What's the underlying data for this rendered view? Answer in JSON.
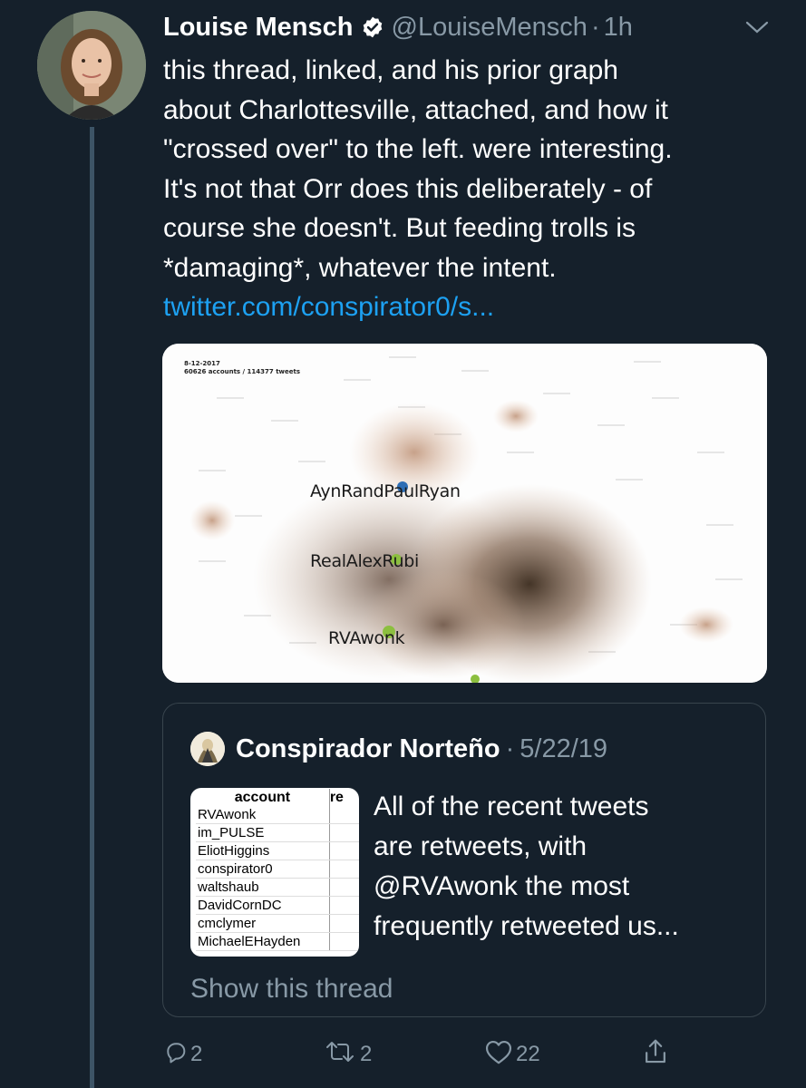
{
  "tweet": {
    "author_name": "Louise Mensch",
    "handle": "@LouiseMensch",
    "separator": "·",
    "time": "1h",
    "body_lines": [
      "this thread, linked, and his prior graph",
      "about Charlottesville, attached, and how it",
      "\"crossed over\" to the left. were interesting.",
      "It's not that Orr does this deliberately - of",
      "course she doesn't. But feeding trolls is",
      "*damaging*, whatever the intent."
    ],
    "link": "twitter.com/conspirator0/s...",
    "icons": {
      "verified": "verified-badge-icon",
      "caret": "chevron-down-icon"
    }
  },
  "media": {
    "date": "8-12-2017",
    "stats": "60626 accounts / 114377 tweets",
    "labels": [
      "AynRandPaulRyan",
      "RealAlexRubi",
      "RVAwonk"
    ]
  },
  "quote": {
    "author_name": "Conspirador Norteño",
    "separator": "·",
    "date": "5/22/19",
    "table": {
      "header": [
        "account",
        "re"
      ],
      "rows": [
        "RVAwonk",
        "im_PULSE",
        "EliotHiggins",
        "conspirator0",
        "waltshaub",
        "DavidCornDC",
        "cmclymer",
        "MichaelEHayden"
      ]
    },
    "text_lines": [
      "All of the recent tweets",
      "are retweets, with",
      "@RVAwonk the most",
      "frequently retweeted us..."
    ],
    "show_thread": "Show this thread"
  },
  "actions": {
    "reply_count": "2",
    "retweet_count": "2",
    "like_count": "22",
    "icons": [
      "reply-icon",
      "retweet-icon",
      "like-icon",
      "share-icon"
    ]
  },
  "colors": {
    "background": "#15202b",
    "secondary_text": "#8899a6",
    "link": "#1da1f2",
    "verified": "#ffffff",
    "border": "#38444d"
  }
}
